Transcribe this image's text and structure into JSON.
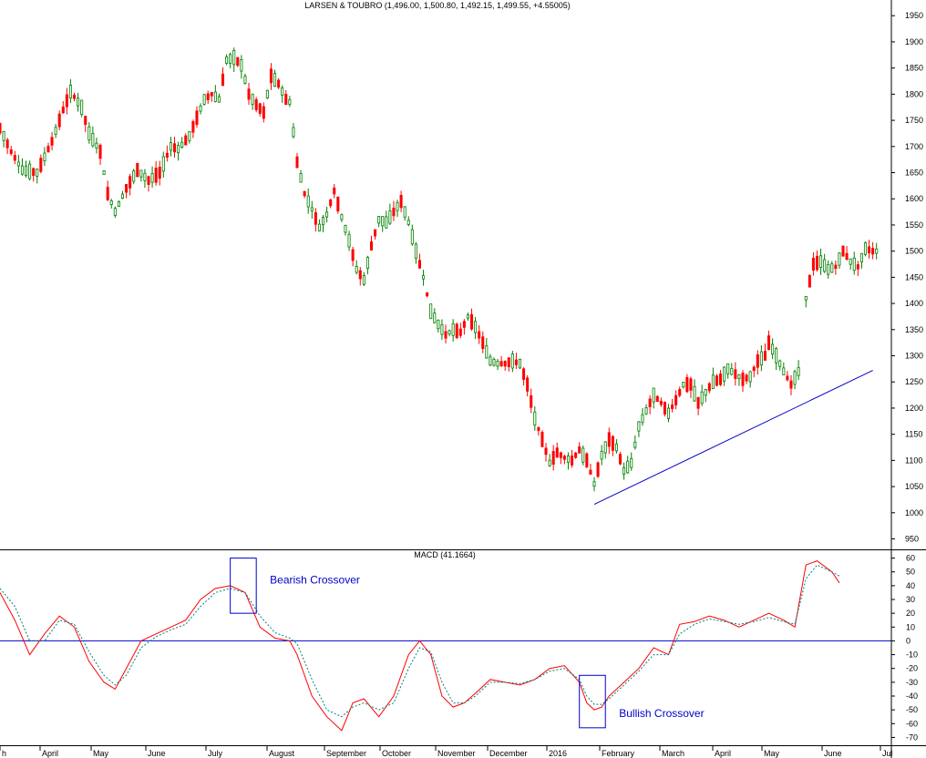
{
  "chart_data": [
    {
      "type": "candlestick",
      "title": "LARSEN & TOUBRO (1,496.00, 1,500.80, 1,492.15, 1,499.55, +4.55005)",
      "ylim": [
        930,
        1980
      ],
      "y_ticks": [
        950,
        1000,
        1050,
        1100,
        1150,
        1200,
        1250,
        1300,
        1350,
        1400,
        1450,
        1500,
        1550,
        1600,
        1650,
        1700,
        1750,
        1800,
        1850,
        1900,
        1950
      ],
      "x_labels": [
        "h",
        "April",
        "May",
        "June",
        "July",
        "August",
        "September",
        "October",
        "November",
        "December",
        "2016",
        "February",
        "March",
        "April",
        "May",
        "June",
        "Jul"
      ],
      "colors": {
        "up": "#008000",
        "down": "#ff0000",
        "trendline": "#0000cc"
      },
      "price_path": [
        [
          0,
          1735
        ],
        [
          3,
          1690
        ],
        [
          6,
          1655
        ],
        [
          10,
          1650
        ],
        [
          14,
          1710
        ],
        [
          17,
          1770
        ],
        [
          19,
          1805
        ],
        [
          22,
          1775
        ],
        [
          24,
          1725
        ],
        [
          27,
          1690
        ],
        [
          29,
          1610
        ],
        [
          31,
          1575
        ],
        [
          34,
          1620
        ],
        [
          37,
          1655
        ],
        [
          40,
          1635
        ],
        [
          43,
          1650
        ],
        [
          46,
          1700
        ],
        [
          48,
          1695
        ],
        [
          51,
          1720
        ],
        [
          53,
          1755
        ],
        [
          55,
          1790
        ],
        [
          57,
          1800
        ],
        [
          59,
          1790
        ],
        [
          61,
          1865
        ],
        [
          63,
          1870
        ],
        [
          65,
          1855
        ],
        [
          67,
          1800
        ],
        [
          69,
          1780
        ],
        [
          71,
          1765
        ],
        [
          73,
          1835
        ],
        [
          75,
          1820
        ],
        [
          77,
          1790
        ],
        [
          78,
          1785
        ],
        [
          80,
          1670
        ],
        [
          82,
          1610
        ],
        [
          84,
          1580
        ],
        [
          86,
          1545
        ],
        [
          88,
          1570
        ],
        [
          90,
          1615
        ],
        [
          92,
          1565
        ],
        [
          94,
          1520
        ],
        [
          96,
          1465
        ],
        [
          98,
          1445
        ],
        [
          100,
          1510
        ],
        [
          102,
          1560
        ],
        [
          104,
          1555
        ],
        [
          106,
          1575
        ],
        [
          108,
          1595
        ],
        [
          110,
          1555
        ],
        [
          112,
          1500
        ],
        [
          114,
          1450
        ],
        [
          116,
          1385
        ],
        [
          118,
          1360
        ],
        [
          120,
          1340
        ],
        [
          122,
          1350
        ],
        [
          124,
          1345
        ],
        [
          126,
          1375
        ],
        [
          128,
          1355
        ],
        [
          130,
          1325
        ],
        [
          132,
          1290
        ],
        [
          134,
          1285
        ],
        [
          136,
          1285
        ],
        [
          138,
          1290
        ],
        [
          140,
          1285
        ],
        [
          142,
          1245
        ],
        [
          144,
          1180
        ],
        [
          146,
          1140
        ],
        [
          148,
          1095
        ],
        [
          150,
          1115
        ],
        [
          152,
          1105
        ],
        [
          154,
          1100
        ],
        [
          156,
          1120
        ],
        [
          158,
          1100
        ],
        [
          160,
          1055
        ],
        [
          162,
          1110
        ],
        [
          164,
          1140
        ],
        [
          166,
          1125
        ],
        [
          168,
          1080
        ],
        [
          170,
          1095
        ],
        [
          172,
          1165
        ],
        [
          174,
          1195
        ],
        [
          176,
          1225
        ],
        [
          178,
          1210
        ],
        [
          180,
          1190
        ],
        [
          182,
          1215
        ],
        [
          184,
          1245
        ],
        [
          186,
          1245
        ],
        [
          188,
          1210
        ],
        [
          190,
          1230
        ],
        [
          192,
          1250
        ],
        [
          194,
          1255
        ],
        [
          196,
          1275
        ],
        [
          198,
          1265
        ],
        [
          200,
          1255
        ],
        [
          202,
          1260
        ],
        [
          204,
          1290
        ],
        [
          206,
          1300
        ],
        [
          207,
          1325
        ],
        [
          209,
          1300
        ],
        [
          211,
          1270
        ],
        [
          213,
          1245
        ],
        [
          215,
          1270
        ],
        [
          217,
          1410
        ],
        [
          219,
          1475
        ],
        [
          221,
          1480
        ],
        [
          223,
          1465
        ],
        [
          225,
          1470
        ],
        [
          227,
          1500
        ],
        [
          229,
          1480
        ],
        [
          231,
          1470
        ],
        [
          233,
          1505
        ],
        [
          235,
          1500
        ],
        [
          236,
          1500
        ]
      ],
      "trendline": [
        [
          1016,
          160
        ],
        [
          1272,
          183
        ]
      ],
      "trendline_axis": "data-units (price) from first to second point",
      "trendline_points": [
        {
          "price": 1016,
          "i": 160
        },
        {
          "price": 1272,
          "i": 235
        }
      ]
    },
    {
      "type": "line",
      "title": "MACD (41.1664)",
      "ylim": [
        -75,
        65
      ],
      "y_ticks": [
        60,
        50,
        40,
        30,
        20,
        10,
        0,
        -10,
        -20,
        -30,
        -40,
        -50,
        -60,
        -70
      ],
      "series": [
        {
          "color": "#ff0000",
          "values": [
            [
              0,
              35
            ],
            [
              4,
              15
            ],
            [
              8,
              -10
            ],
            [
              12,
              5
            ],
            [
              16,
              18
            ],
            [
              20,
              10
            ],
            [
              24,
              -15
            ],
            [
              28,
              -30
            ],
            [
              31,
              -35
            ],
            [
              34,
              -20
            ],
            [
              38,
              0
            ],
            [
              42,
              5
            ],
            [
              46,
              10
            ],
            [
              50,
              15
            ],
            [
              54,
              30
            ],
            [
              58,
              38
            ],
            [
              62,
              40
            ],
            [
              66,
              35
            ],
            [
              70,
              10
            ],
            [
              74,
              2
            ],
            [
              78,
              0
            ],
            [
              80,
              -10
            ],
            [
              84,
              -40
            ],
            [
              88,
              -55
            ],
            [
              92,
              -65
            ],
            [
              95,
              -45
            ],
            [
              98,
              -42
            ],
            [
              102,
              -55
            ],
            [
              106,
              -40
            ],
            [
              110,
              -10
            ],
            [
              113,
              0
            ],
            [
              116,
              -10
            ],
            [
              119,
              -40
            ],
            [
              122,
              -48
            ],
            [
              125,
              -45
            ],
            [
              128,
              -38
            ],
            [
              132,
              -28
            ],
            [
              136,
              -30
            ],
            [
              140,
              -32
            ],
            [
              144,
              -28
            ],
            [
              148,
              -20
            ],
            [
              152,
              -18
            ],
            [
              156,
              -30
            ],
            [
              158,
              -45
            ],
            [
              160,
              -50
            ],
            [
              162,
              -48
            ],
            [
              164,
              -40
            ],
            [
              168,
              -30
            ],
            [
              172,
              -20
            ],
            [
              176,
              -5
            ],
            [
              180,
              -10
            ],
            [
              183,
              12
            ],
            [
              187,
              14
            ],
            [
              191,
              18
            ],
            [
              195,
              15
            ],
            [
              199,
              10
            ],
            [
              203,
              15
            ],
            [
              207,
              20
            ],
            [
              211,
              15
            ],
            [
              214,
              10
            ],
            [
              217,
              55
            ],
            [
              220,
              58
            ],
            [
              224,
              50
            ],
            [
              226,
              42
            ]
          ]
        },
        {
          "color": "#008080",
          "dashed": true,
          "values": [
            [
              0,
              38
            ],
            [
              4,
              25
            ],
            [
              8,
              0
            ],
            [
              12,
              0
            ],
            [
              16,
              15
            ],
            [
              20,
              12
            ],
            [
              24,
              -8
            ],
            [
              28,
              -25
            ],
            [
              31,
              -32
            ],
            [
              34,
              -25
            ],
            [
              38,
              -5
            ],
            [
              42,
              3
            ],
            [
              46,
              8
            ],
            [
              50,
              12
            ],
            [
              54,
              25
            ],
            [
              58,
              35
            ],
            [
              62,
              38
            ],
            [
              66,
              35
            ],
            [
              70,
              18
            ],
            [
              74,
              6
            ],
            [
              78,
              2
            ],
            [
              80,
              -2
            ],
            [
              84,
              -28
            ],
            [
              88,
              -50
            ],
            [
              92,
              -55
            ],
            [
              95,
              -48
            ],
            [
              98,
              -45
            ],
            [
              102,
              -50
            ],
            [
              106,
              -45
            ],
            [
              110,
              -20
            ],
            [
              113,
              -5
            ],
            [
              116,
              -8
            ],
            [
              119,
              -30
            ],
            [
              122,
              -45
            ],
            [
              125,
              -45
            ],
            [
              128,
              -40
            ],
            [
              132,
              -30
            ],
            [
              136,
              -30
            ],
            [
              140,
              -31
            ],
            [
              144,
              -28
            ],
            [
              148,
              -22
            ],
            [
              152,
              -20
            ],
            [
              156,
              -28
            ],
            [
              158,
              -40
            ],
            [
              160,
              -46
            ],
            [
              162,
              -46
            ],
            [
              164,
              -42
            ],
            [
              168,
              -32
            ],
            [
              172,
              -22
            ],
            [
              176,
              -10
            ],
            [
              180,
              -10
            ],
            [
              183,
              5
            ],
            [
              187,
              12
            ],
            [
              191,
              16
            ],
            [
              195,
              14
            ],
            [
              199,
              12
            ],
            [
              203,
              14
            ],
            [
              207,
              17
            ],
            [
              211,
              14
            ],
            [
              214,
              12
            ],
            [
              217,
              45
            ],
            [
              220,
              55
            ],
            [
              224,
              50
            ],
            [
              226,
              47
            ]
          ]
        }
      ],
      "zero_line_color": "#0000cc",
      "annotations": [
        {
          "text": "Bearish Crossover",
          "box_i": [
            62,
            69
          ],
          "box_y": [
            20,
            60
          ]
        },
        {
          "text": "Bullish Crossover",
          "box_i": [
            156,
            163
          ],
          "box_y": [
            -63,
            -25
          ]
        }
      ]
    }
  ]
}
